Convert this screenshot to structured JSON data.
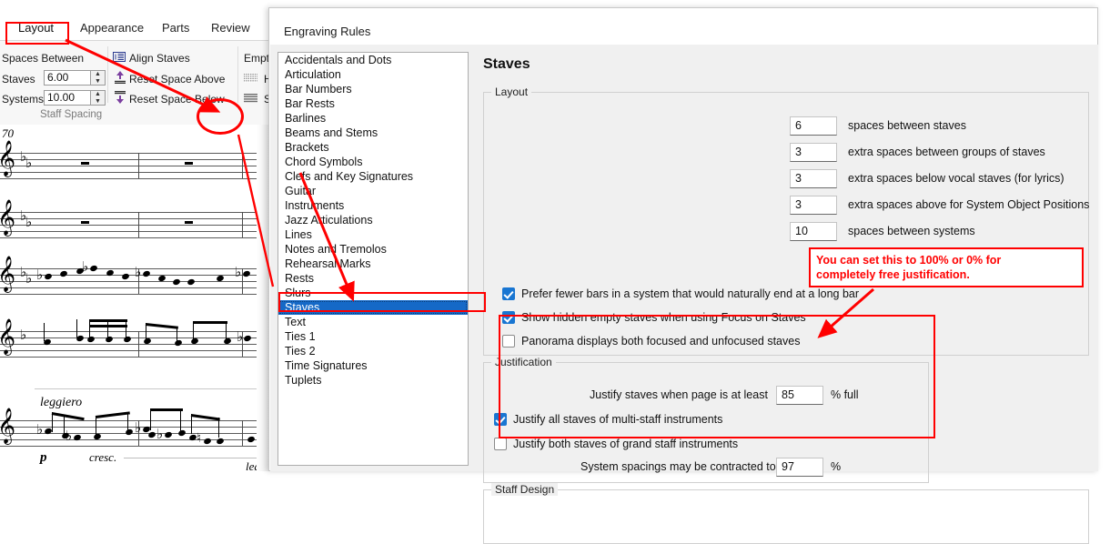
{
  "ribbon": {
    "tabs": [
      {
        "label": "Layout",
        "active": true
      },
      {
        "label": "Appearance",
        "active": false
      },
      {
        "label": "Parts",
        "active": false
      },
      {
        "label": "Review",
        "active": false
      }
    ],
    "staff_spacing_group": {
      "group_label": "Staff Spacing",
      "header": "Spaces Between",
      "rows": [
        {
          "label": "Staves",
          "value": "6.00"
        },
        {
          "label": "Systems",
          "value": "10.00"
        }
      ],
      "buttons": [
        {
          "label": "Align Staves",
          "icon": "align-staves-icon"
        },
        {
          "label": "Reset Space Above",
          "icon": "arrow-up-icon"
        },
        {
          "label": "Reset Space Below",
          "icon": "arrow-down-icon"
        }
      ],
      "dialog_launcher_icon": "dialog-launcher-icon"
    },
    "empty_staves_group": {
      "header": "Empt",
      "buttons": [
        {
          "label": "H",
          "icon": "hide-empty-staves-icon"
        },
        {
          "label": "Sl",
          "icon": "show-empty-staves-icon"
        }
      ]
    }
  },
  "score": {
    "bar_number": "70",
    "expressions": [
      "leggiero",
      "cresc.",
      "leg"
    ],
    "dynamics": [
      "p"
    ]
  },
  "dialog": {
    "title": "Engraving Rules",
    "categories": [
      "Accidentals and Dots",
      "Articulation",
      "Bar Numbers",
      "Bar Rests",
      "Barlines",
      "Beams and Stems",
      "Brackets",
      "Chord Symbols",
      "Clefs and Key Signatures",
      "Guitar",
      "Instruments",
      "Jazz Articulations",
      "Lines",
      "Notes and Tremolos",
      "Rehearsal Marks",
      "Rests",
      "Slurs",
      "Staves",
      "Text",
      "Ties 1",
      "Ties 2",
      "Time Signatures",
      "Tuplets"
    ],
    "selected_category": "Staves",
    "pane_title": "Staves",
    "layout_group": {
      "legend": "Layout",
      "fields": [
        {
          "value": "6",
          "label": "spaces between staves"
        },
        {
          "value": "3",
          "label": "extra spaces between groups of staves"
        },
        {
          "value": "3",
          "label": "extra spaces below vocal staves (for lyrics)"
        },
        {
          "value": "3",
          "label": "extra spaces above for System Object Positions"
        },
        {
          "value": "10",
          "label": "spaces between systems"
        }
      ],
      "checkboxes": [
        {
          "label": "Prefer fewer bars in a system that would naturally end at a long bar",
          "checked": true
        },
        {
          "label": "Show hidden empty staves when using Focus on Staves",
          "checked": true
        },
        {
          "label": "Panorama displays both focused and unfocused staves",
          "checked": false
        }
      ]
    },
    "justification_group": {
      "legend": "Justification",
      "row1": {
        "label": "Justify staves when page is at least",
        "value": "85",
        "suffix": "% full"
      },
      "checkboxes": [
        {
          "label": "Justify all staves of multi-staff instruments",
          "checked": true
        },
        {
          "label": "Justify both staves of grand staff instruments",
          "checked": false
        }
      ],
      "row2": {
        "label": "System spacings may be contracted to",
        "value": "97",
        "suffix": "%"
      }
    },
    "staff_design_group": {
      "legend": "Staff Design"
    }
  },
  "annotations": {
    "note_line1": "You can set this to 100% or 0% for",
    "note_line2": "completely free justification.",
    "color": "#ff0000"
  }
}
